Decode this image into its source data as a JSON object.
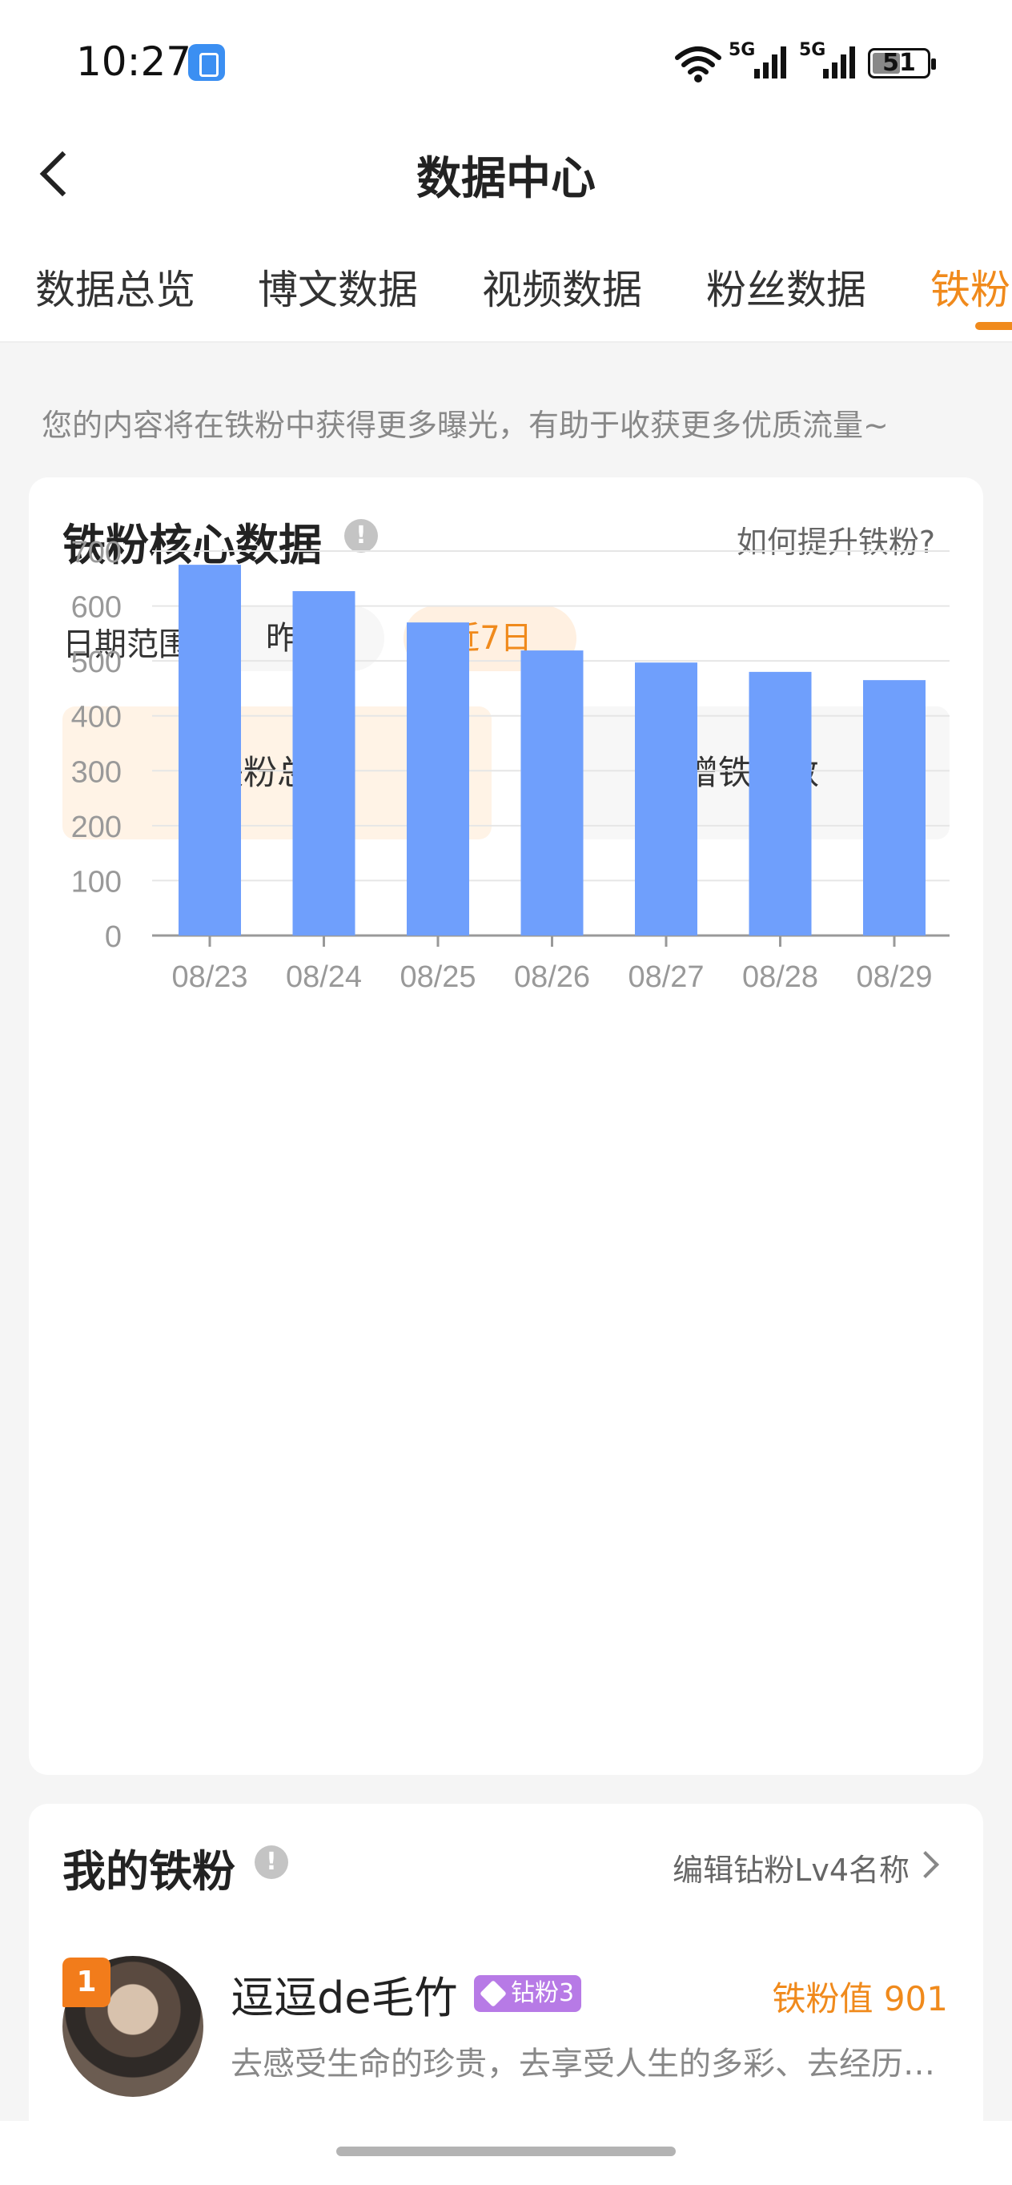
{
  "status_bar": {
    "time": "10:27",
    "network_1": "5G",
    "network_2": "5G",
    "wifi_badge": "6",
    "battery": "51",
    "battery_level": 0.51
  },
  "header": {
    "title": "数据中心"
  },
  "tabs": [
    {
      "label": "数据总览",
      "active": false
    },
    {
      "label": "博文数据",
      "active": false
    },
    {
      "label": "视频数据",
      "active": false
    },
    {
      "label": "粉丝数据",
      "active": false
    },
    {
      "label": "铁粉数据",
      "active": true
    }
  ],
  "notice": "您的内容将在铁粉中获得更多曝光，有助于收获更多优质流量~",
  "core_card": {
    "title": "铁粉核心数据",
    "help_link": "如何提升铁粉?",
    "date_range_label": "日期范围",
    "date_options": [
      "昨日",
      "近7日"
    ],
    "selected_date_option": "近7日",
    "metrics": [
      "铁粉总数",
      "新增铁粉数"
    ],
    "selected_metric": "铁粉总数"
  },
  "chart_data": {
    "type": "bar",
    "categories": [
      "08/23",
      "08/24",
      "08/25",
      "08/26",
      "08/27",
      "08/28",
      "08/29"
    ],
    "values": [
      675,
      627,
      570,
      519,
      497,
      480,
      465
    ],
    "ylim": [
      0,
      700
    ],
    "yticks": [
      0,
      100,
      200,
      300,
      400,
      500,
      600,
      700
    ],
    "grid": true,
    "bar_color": "#6f9ffc"
  },
  "fans_card": {
    "title": "我的铁粉",
    "edit_link": "编辑钻粉Lv4名称",
    "fans": [
      {
        "rank": "1",
        "name": "逗逗de毛竹",
        "badge": "钻粉3",
        "value_label": "铁粉值 901",
        "desc": "去感受生命的珍贵，去享受人生的多彩、去经历更多美好"
      }
    ]
  },
  "colors": {
    "accent": "#f08a1c",
    "chart_bar": "#6f9ffc",
    "badge_purple": "#b77ae6"
  }
}
